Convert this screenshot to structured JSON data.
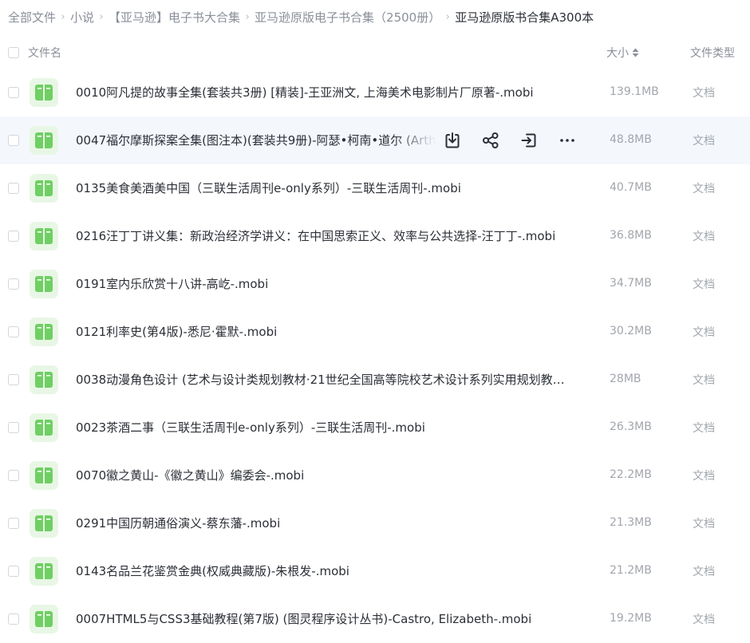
{
  "breadcrumb": [
    "全部文件",
    "小说",
    "【亚马逊】电子书大合集",
    "亚马逊原版电子书合集（2500册）",
    "亚马逊原版书合集A300本"
  ],
  "header": {
    "name_label": "文件名",
    "size_label": "大小",
    "type_label": "文件类型"
  },
  "colors": {
    "file_icon_green": "#6fcf63",
    "hover_row_bg": "#f4f8fd"
  },
  "row_action_icons": [
    "download-icon",
    "share-icon",
    "move-icon",
    "more-icon"
  ],
  "files": [
    {
      "name": "0010阿凡提的故事全集(套装共3册) [精装]-王亚洲文, 上海美术电影制片厂原著-.mobi",
      "size": "139.1MB",
      "type": "文档"
    },
    {
      "name": "0047福尔摩斯探案全集(图注本)(套装共9册)-阿瑟•柯南•道尔 (Arthur",
      "size": "48.8MB",
      "type": "文档",
      "hovered": true
    },
    {
      "name": "0135美食美酒美中国（三联生活周刊e-only系列）-三联生活周刊-.mobi",
      "size": "40.7MB",
      "type": "文档"
    },
    {
      "name": "0216汪丁丁讲义集：新政治经济学讲义：在中国思索正义、效率与公共选择-汪丁丁-.mobi",
      "size": "36.8MB",
      "type": "文档"
    },
    {
      "name": "0191室内乐欣赏十八讲-高屹-.mobi",
      "size": "34.7MB",
      "type": "文档"
    },
    {
      "name": "0121利率史(第4版)-悉尼·霍默-.mobi",
      "size": "30.2MB",
      "type": "文档"
    },
    {
      "name": "0038动漫角色设计 (艺术与设计类规划教材·21世纪全国高等院校艺术设计系列实用规划教材…",
      "size": "28MB",
      "type": "文档"
    },
    {
      "name": "0023茶酒二事（三联生活周刊e-only系列）-三联生活周刊-.mobi",
      "size": "26.3MB",
      "type": "文档"
    },
    {
      "name": "0070徽之黄山-《徽之黄山》编委会-.mobi",
      "size": "22.2MB",
      "type": "文档"
    },
    {
      "name": "0291中国历朝通俗演义-蔡东藩-.mobi",
      "size": "21.3MB",
      "type": "文档"
    },
    {
      "name": "0143名品兰花鉴赏金典(权威典藏版)-朱根发-.mobi",
      "size": "21.2MB",
      "type": "文档"
    },
    {
      "name": "0007HTML5与CSS3基础教程(第7版) (图灵程序设计丛书)-Castro, Elizabeth-.mobi",
      "size": "19.2MB",
      "type": "文档"
    }
  ]
}
